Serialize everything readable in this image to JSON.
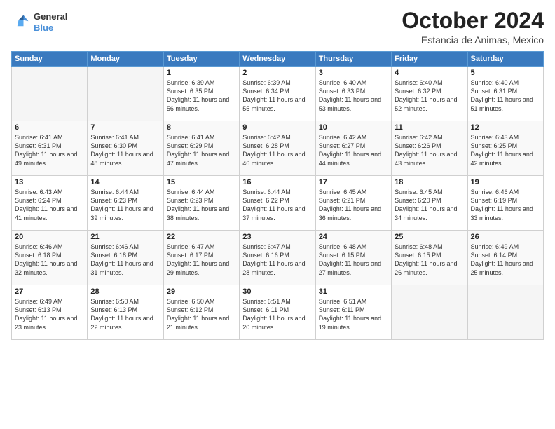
{
  "header": {
    "logo_line1": "General",
    "logo_line2": "Blue",
    "month": "October 2024",
    "location": "Estancia de Animas, Mexico"
  },
  "days_of_week": [
    "Sunday",
    "Monday",
    "Tuesday",
    "Wednesday",
    "Thursday",
    "Friday",
    "Saturday"
  ],
  "weeks": [
    [
      {
        "num": "",
        "info": ""
      },
      {
        "num": "",
        "info": ""
      },
      {
        "num": "1",
        "info": "Sunrise: 6:39 AM\nSunset: 6:35 PM\nDaylight: 11 hours and 56 minutes."
      },
      {
        "num": "2",
        "info": "Sunrise: 6:39 AM\nSunset: 6:34 PM\nDaylight: 11 hours and 55 minutes."
      },
      {
        "num": "3",
        "info": "Sunrise: 6:40 AM\nSunset: 6:33 PM\nDaylight: 11 hours and 53 minutes."
      },
      {
        "num": "4",
        "info": "Sunrise: 6:40 AM\nSunset: 6:32 PM\nDaylight: 11 hours and 52 minutes."
      },
      {
        "num": "5",
        "info": "Sunrise: 6:40 AM\nSunset: 6:31 PM\nDaylight: 11 hours and 51 minutes."
      }
    ],
    [
      {
        "num": "6",
        "info": "Sunrise: 6:41 AM\nSunset: 6:31 PM\nDaylight: 11 hours and 49 minutes."
      },
      {
        "num": "7",
        "info": "Sunrise: 6:41 AM\nSunset: 6:30 PM\nDaylight: 11 hours and 48 minutes."
      },
      {
        "num": "8",
        "info": "Sunrise: 6:41 AM\nSunset: 6:29 PM\nDaylight: 11 hours and 47 minutes."
      },
      {
        "num": "9",
        "info": "Sunrise: 6:42 AM\nSunset: 6:28 PM\nDaylight: 11 hours and 46 minutes."
      },
      {
        "num": "10",
        "info": "Sunrise: 6:42 AM\nSunset: 6:27 PM\nDaylight: 11 hours and 44 minutes."
      },
      {
        "num": "11",
        "info": "Sunrise: 6:42 AM\nSunset: 6:26 PM\nDaylight: 11 hours and 43 minutes."
      },
      {
        "num": "12",
        "info": "Sunrise: 6:43 AM\nSunset: 6:25 PM\nDaylight: 11 hours and 42 minutes."
      }
    ],
    [
      {
        "num": "13",
        "info": "Sunrise: 6:43 AM\nSunset: 6:24 PM\nDaylight: 11 hours and 41 minutes."
      },
      {
        "num": "14",
        "info": "Sunrise: 6:44 AM\nSunset: 6:23 PM\nDaylight: 11 hours and 39 minutes."
      },
      {
        "num": "15",
        "info": "Sunrise: 6:44 AM\nSunset: 6:23 PM\nDaylight: 11 hours and 38 minutes."
      },
      {
        "num": "16",
        "info": "Sunrise: 6:44 AM\nSunset: 6:22 PM\nDaylight: 11 hours and 37 minutes."
      },
      {
        "num": "17",
        "info": "Sunrise: 6:45 AM\nSunset: 6:21 PM\nDaylight: 11 hours and 36 minutes."
      },
      {
        "num": "18",
        "info": "Sunrise: 6:45 AM\nSunset: 6:20 PM\nDaylight: 11 hours and 34 minutes."
      },
      {
        "num": "19",
        "info": "Sunrise: 6:46 AM\nSunset: 6:19 PM\nDaylight: 11 hours and 33 minutes."
      }
    ],
    [
      {
        "num": "20",
        "info": "Sunrise: 6:46 AM\nSunset: 6:18 PM\nDaylight: 11 hours and 32 minutes."
      },
      {
        "num": "21",
        "info": "Sunrise: 6:46 AM\nSunset: 6:18 PM\nDaylight: 11 hours and 31 minutes."
      },
      {
        "num": "22",
        "info": "Sunrise: 6:47 AM\nSunset: 6:17 PM\nDaylight: 11 hours and 29 minutes."
      },
      {
        "num": "23",
        "info": "Sunrise: 6:47 AM\nSunset: 6:16 PM\nDaylight: 11 hours and 28 minutes."
      },
      {
        "num": "24",
        "info": "Sunrise: 6:48 AM\nSunset: 6:15 PM\nDaylight: 11 hours and 27 minutes."
      },
      {
        "num": "25",
        "info": "Sunrise: 6:48 AM\nSunset: 6:15 PM\nDaylight: 11 hours and 26 minutes."
      },
      {
        "num": "26",
        "info": "Sunrise: 6:49 AM\nSunset: 6:14 PM\nDaylight: 11 hours and 25 minutes."
      }
    ],
    [
      {
        "num": "27",
        "info": "Sunrise: 6:49 AM\nSunset: 6:13 PM\nDaylight: 11 hours and 23 minutes."
      },
      {
        "num": "28",
        "info": "Sunrise: 6:50 AM\nSunset: 6:13 PM\nDaylight: 11 hours and 22 minutes."
      },
      {
        "num": "29",
        "info": "Sunrise: 6:50 AM\nSunset: 6:12 PM\nDaylight: 11 hours and 21 minutes."
      },
      {
        "num": "30",
        "info": "Sunrise: 6:51 AM\nSunset: 6:11 PM\nDaylight: 11 hours and 20 minutes."
      },
      {
        "num": "31",
        "info": "Sunrise: 6:51 AM\nSunset: 6:11 PM\nDaylight: 11 hours and 19 minutes."
      },
      {
        "num": "",
        "info": ""
      },
      {
        "num": "",
        "info": ""
      }
    ]
  ]
}
